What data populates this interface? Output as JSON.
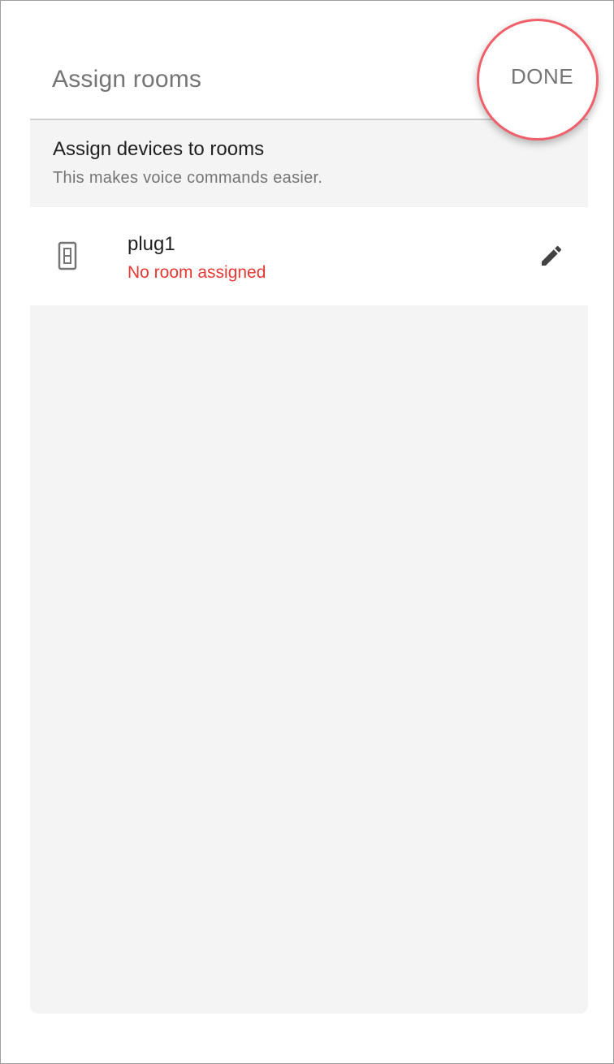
{
  "app_bar": {
    "title": "Assign rooms",
    "done_label": "DONE"
  },
  "intro": {
    "title": "Assign devices to rooms",
    "subtitle": "This makes voice commands easier."
  },
  "devices": [
    {
      "name": "plug1",
      "status": "No room assigned",
      "icon": "outlet-icon",
      "action_icon": "edit-pencil-icon"
    }
  ],
  "colors": {
    "status_unassigned": "#e53935",
    "highlight_ring": "#f0606a",
    "background_gray": "#f4f4f4"
  }
}
